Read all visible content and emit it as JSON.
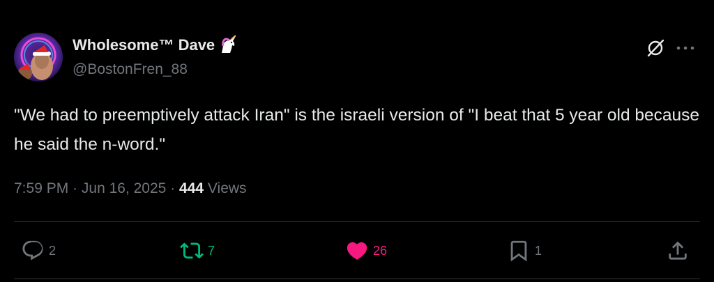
{
  "author": {
    "display_name": "Wholesome™ Dave",
    "handle": "@BostonFren_88",
    "badge_icon": "unicorn-icon"
  },
  "tweet": {
    "text": "\"We had to preemptively attack Iran\" is the israeli version of \"I beat that 5 year old because he said the n-word.\""
  },
  "meta": {
    "time": "7:59 PM",
    "separator": "·",
    "date": "Jun 16, 2025",
    "views_count": "444",
    "views_label": "Views"
  },
  "actions": {
    "replies": "2",
    "retweets": "7",
    "likes": "26",
    "bookmarks": "1"
  },
  "colors": {
    "background": "#000000",
    "text": "#e7e9ea",
    "muted": "#71767b",
    "retweet": "#00ba7c",
    "like": "#f91880"
  }
}
